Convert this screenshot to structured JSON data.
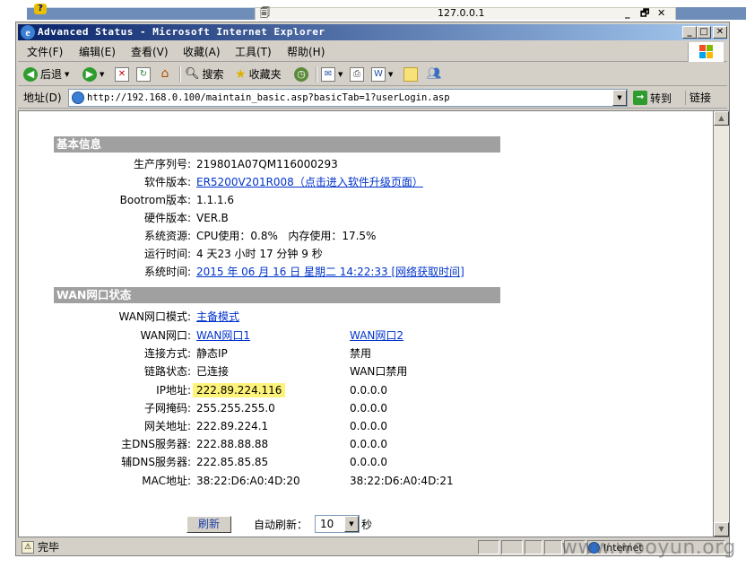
{
  "background": {
    "host": "127.0.0.1",
    "controls": [
      "_",
      "🗗",
      "✕"
    ]
  },
  "window": {
    "title": "Advanced Status - Microsoft Internet Explorer",
    "controls": [
      "_",
      "□",
      "✕"
    ]
  },
  "menu": [
    "文件(F)",
    "编辑(E)",
    "查看(V)",
    "收藏(A)",
    "工具(T)",
    "帮助(H)"
  ],
  "toolbar": {
    "back": "后退",
    "search": "搜索",
    "favorites": "收藏夹"
  },
  "address": {
    "label": "地址(D)",
    "url": "http://192.168.0.100/maintain_basic.asp?basicTab=1?userLogin.asp",
    "go": "转到",
    "links": "链接"
  },
  "basic": {
    "header": "基本信息",
    "rows": [
      {
        "label": "生产序列号:",
        "value": "219801A07QM116000293"
      },
      {
        "label": "软件版本:",
        "value": "ER5200V201R008（点击进入软件升级页面）"
      },
      {
        "label": "Bootrom版本:",
        "value": "1.1.1.6"
      },
      {
        "label": "硬件版本:",
        "value": "VER.B"
      },
      {
        "label": "系统资源:",
        "value": "CPU使用：0.8%   内存使用：17.5%"
      },
      {
        "label": "运行时间:",
        "value": "4 天23 小时 17 分钟 9 秒"
      },
      {
        "label": "系统时间:",
        "value": "2015 年 06 月 16 日 星期二 14:22:33 [网络获取时间]"
      }
    ]
  },
  "wan": {
    "header": "WAN网口状态",
    "mode_label": "WAN网口模式:",
    "mode_value": "主备模式",
    "rows": [
      {
        "label": "WAN网口:",
        "v1": "WAN网口1",
        "v2": "WAN网口2"
      },
      {
        "label": "连接方式:",
        "v1": "静态IP",
        "v2": "禁用"
      },
      {
        "label": "链路状态:",
        "v1": "已连接",
        "v2": "WAN口禁用"
      },
      {
        "label": "IP地址:",
        "v1": "222.89.224.116",
        "v2": "0.0.0.0"
      },
      {
        "label": "子网掩码:",
        "v1": "255.255.255.0",
        "v2": "0.0.0.0"
      },
      {
        "label": "网关地址:",
        "v1": "222.89.224.1",
        "v2": "0.0.0.0"
      },
      {
        "label": "主DNS服务器:",
        "v1": "222.88.88.88",
        "v2": "0.0.0.0"
      },
      {
        "label": "辅DNS服务器:",
        "v1": "222.85.85.85",
        "v2": "0.0.0.0"
      },
      {
        "label": "MAC地址:",
        "v1": "38:22:D6:A0:4D:20",
        "v2": "38:22:D6:A0:4D:21"
      }
    ]
  },
  "refresh": {
    "button": "刷新",
    "auto_label": "自动刷新：",
    "interval": "10",
    "unit": "秒"
  },
  "status": {
    "text": "完毕",
    "zone": "Internet"
  },
  "watermark": "www.wooyun.org",
  "colors": {
    "section_header": "#a0a0a0",
    "link": "#0033cc",
    "highlight": "#fdf37a",
    "titlebar_start": "#0a246a"
  }
}
